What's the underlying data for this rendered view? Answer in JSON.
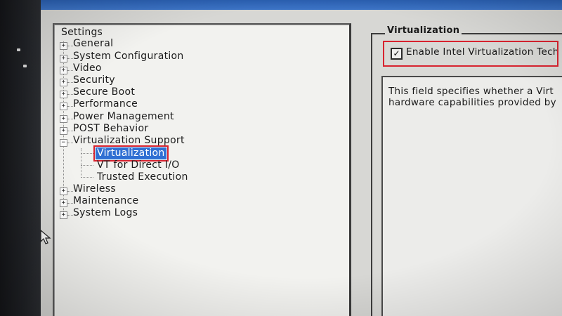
{
  "tree": {
    "root_label": "Settings",
    "items": [
      {
        "label": "General",
        "expander": "+"
      },
      {
        "label": "System Configuration",
        "expander": "+"
      },
      {
        "label": "Video",
        "expander": "+"
      },
      {
        "label": "Security",
        "expander": "+"
      },
      {
        "label": "Secure Boot",
        "expander": "+"
      },
      {
        "label": "Performance",
        "expander": "+"
      },
      {
        "label": "Power Management",
        "expander": "+"
      },
      {
        "label": "POST Behavior",
        "expander": "+"
      },
      {
        "label": "Virtualization Support",
        "expander": "−"
      },
      {
        "label": "Wireless",
        "expander": "+"
      },
      {
        "label": "Maintenance",
        "expander": "+"
      },
      {
        "label": "System Logs",
        "expander": "+"
      }
    ],
    "children": [
      {
        "label": "Virtualization",
        "selected": true
      },
      {
        "label": "VT for Direct I/O",
        "selected": false
      },
      {
        "label": "Trusted Execution",
        "selected": false
      }
    ]
  },
  "detail": {
    "group_title": "Virtualization",
    "option_label": "Enable Intel Virtualization Techno",
    "option_checked": true,
    "checkbox_mark": "✓",
    "help_line_1": "This field specifies whether a Virt",
    "help_line_2": "hardware capabilities provided by"
  },
  "colors": {
    "selection": "#2f6fd3",
    "highlight_box": "#d8232f"
  }
}
